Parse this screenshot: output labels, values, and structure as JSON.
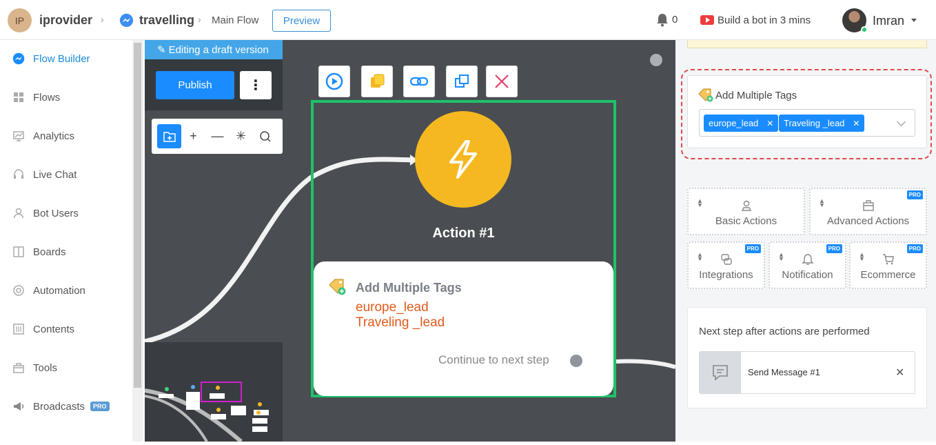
{
  "header": {
    "avatar_initials": "IP",
    "brand": "iprovider",
    "crumb_page": "travelling",
    "crumb_flow": "Main Flow",
    "preview_label": "Preview",
    "notif_count": "0",
    "build_label": "Build a bot in 3 mins",
    "user_name": "Imran"
  },
  "sidebar": {
    "items": [
      {
        "label": "Flow Builder",
        "icon": "messenger-icon"
      },
      {
        "label": "Flows",
        "icon": "grid-icon"
      },
      {
        "label": "Analytics",
        "icon": "chart-icon"
      },
      {
        "label": "Live Chat",
        "icon": "headset-icon"
      },
      {
        "label": "Bot Users",
        "icon": "user-icon"
      },
      {
        "label": "Boards",
        "icon": "board-icon"
      },
      {
        "label": "Automation",
        "icon": "automation-icon"
      },
      {
        "label": "Contents",
        "icon": "contents-icon"
      },
      {
        "label": "Tools",
        "icon": "tools-icon"
      },
      {
        "label": "Broadcasts",
        "icon": "megaphone-icon"
      }
    ],
    "pro_label": "PRO"
  },
  "canvas": {
    "draft_label": "Editing a draft version",
    "publish_label": "Publish",
    "node_title": "Action #1",
    "card_title": "Add Multiple Tags",
    "card_tags": [
      "europe_lead",
      "Traveling _lead"
    ],
    "continue_label": "Continue to next step"
  },
  "right_panel": {
    "tags_label": "Add Multiple Tags",
    "tags": [
      "europe_lead",
      "Traveling _lead"
    ],
    "actions": [
      {
        "label": "Basic Actions",
        "pro": false
      },
      {
        "label": "Advanced Actions",
        "pro": true
      },
      {
        "label": "Integrations",
        "pro": true
      },
      {
        "label": "Notification",
        "pro": true
      },
      {
        "label": "Ecommerce",
        "pro": true
      }
    ],
    "pro_label": "PRO",
    "next_step_label": "Next step after actions are performed",
    "next_step_item": "Send Message #1"
  },
  "colors": {
    "accent": "#1a8cff",
    "node_border": "#1ec26a",
    "bolt": "#f6b820",
    "tag_text": "#e25a1c",
    "highlight_dashed": "#e04848"
  }
}
